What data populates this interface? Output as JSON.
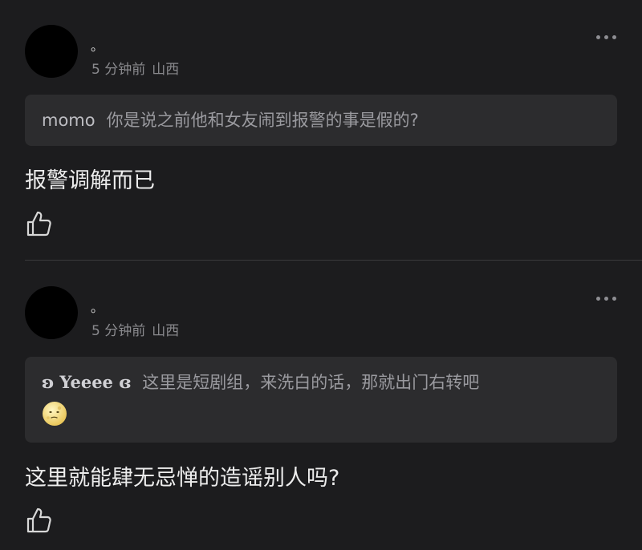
{
  "comments": [
    {
      "username": "。",
      "time": "5 分钟前",
      "location": "山西",
      "quote": {
        "name": "momo",
        "text": "你是说之前他和女友闹到报警的事是假的?"
      },
      "body": "报警调解而已"
    },
    {
      "username": "。",
      "time": "5 分钟前",
      "location": "山西",
      "quote": {
        "name": "ʚ Yeeee ɞ",
        "text": "这里是短剧组，来洗白的话，那就出门右转吧",
        "emoji": "pale-moon-face-emoji"
      },
      "body": "这里就能肆无忌惮的造谣别人吗?"
    }
  ],
  "icons": {
    "like": "thumbs-up-icon",
    "more": "more-dots-icon"
  },
  "colors": {
    "background": "#1c1c1e",
    "quote_background": "#2c2c2e",
    "meta_text": "#8a8a8e"
  }
}
